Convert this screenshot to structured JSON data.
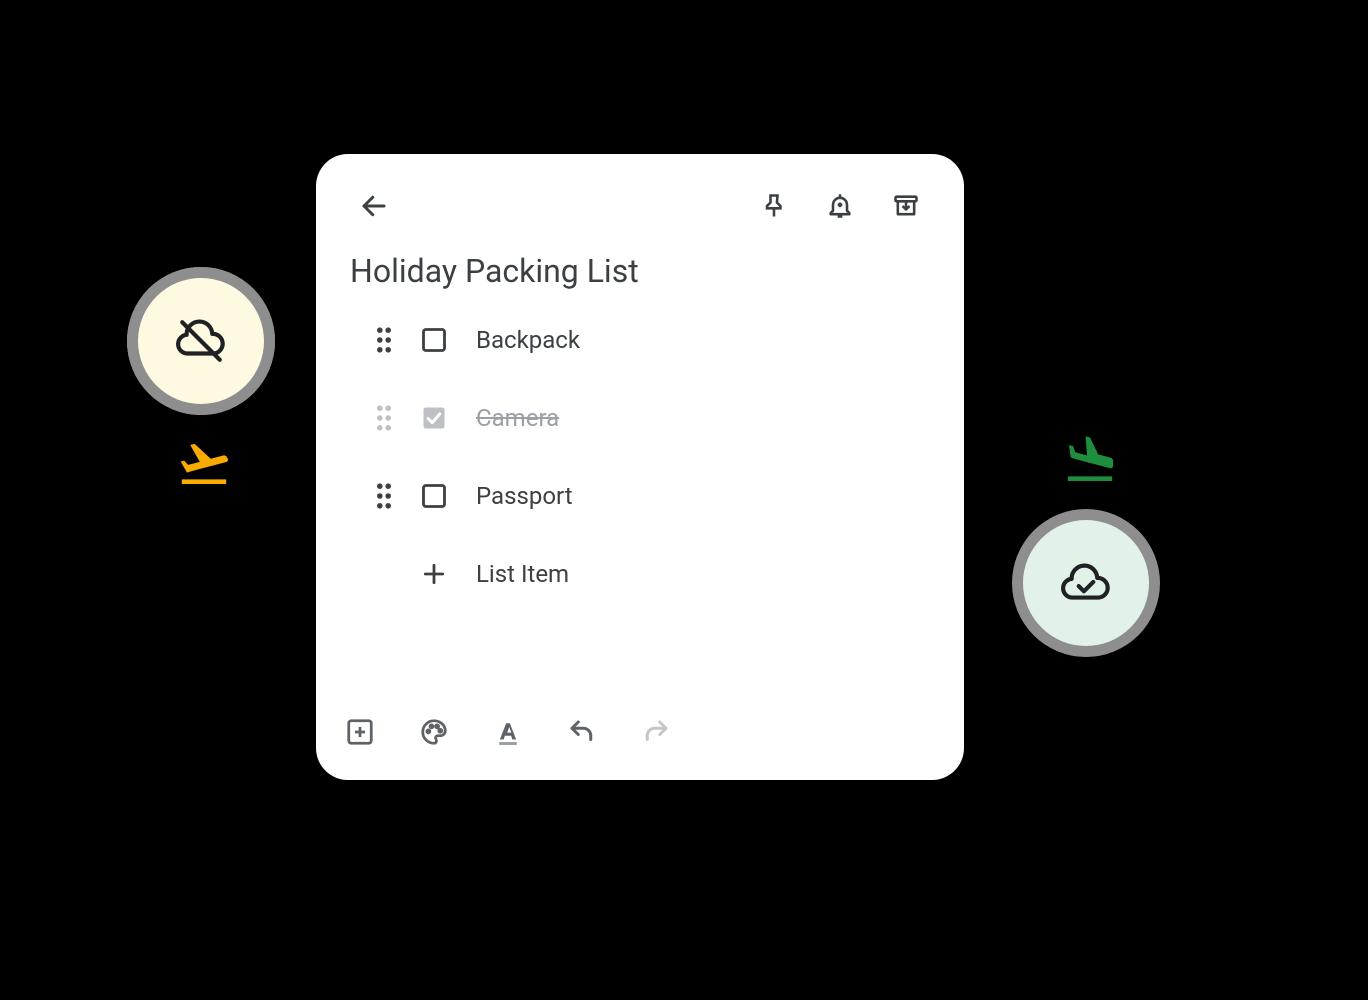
{
  "note": {
    "title": "Holiday Packing List",
    "items": [
      {
        "label": "Backpack",
        "checked": false
      },
      {
        "label": "Camera",
        "checked": true
      },
      {
        "label": "Passport",
        "checked": false
      }
    ],
    "add_placeholder": "List Item"
  },
  "header_icons": {
    "back": "arrow-back",
    "pin": "push-pin",
    "reminder": "add-alert",
    "archive": "archive"
  },
  "toolbar_icons": {
    "add": "add-box",
    "palette": "palette",
    "text_format": "text-format",
    "undo": "undo",
    "redo": "redo"
  },
  "redo_enabled": false,
  "badges": {
    "left": {
      "icon": "cloud-off",
      "bg": "#fef9e1"
    },
    "right": {
      "icon": "cloud-done",
      "bg": "#e3f2e9"
    }
  },
  "planes": {
    "left": {
      "icon": "flight-takeoff",
      "color": "#f9ab00"
    },
    "right": {
      "icon": "flight-land",
      "color": "#1e8e3e"
    }
  }
}
